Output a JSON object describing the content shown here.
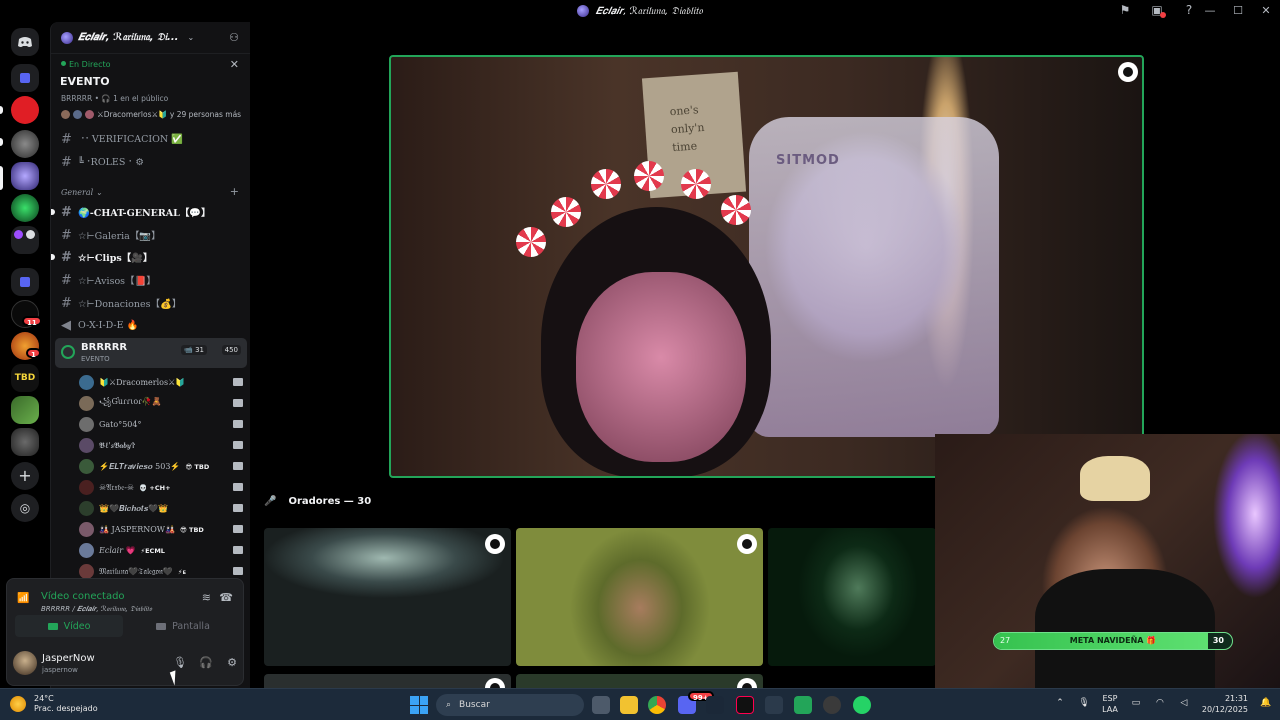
{
  "window": {
    "title": "𝑬𝒄𝒍𝒂𝒊𝒓, ℛ𝔞𝔯𝔦𝔩𝔲𝔫𝔞, 𝔇𝔦𝔞𝔟𝔩𝔦𝔱𝔬",
    "icons": [
      "flag-icon",
      "inbox-icon",
      "help-icon"
    ],
    "controls": [
      "minimize-icon",
      "maximize-icon",
      "close-icon"
    ]
  },
  "server_rail": {
    "badges": [
      "11",
      "1"
    ]
  },
  "server": {
    "name": "𝑬𝒄𝒍𝒂𝒊𝒓, ℛ𝔞𝔯𝔦𝔩𝔲𝔫𝔞, 𝔇𝔦...",
    "event": {
      "live_label": "En Directo",
      "title": "EVENTO",
      "meta": "BRRRRR • 🎧 1 en el público",
      "people": "⚔Dracomerlos⚔🔰 y 29 personas más"
    }
  },
  "channels": [
    {
      "label": "⠐⠂VERIFICACION ✅",
      "bold": false
    },
    {
      "label": "╚⠐ROLES⠐ ⚙",
      "bold": false
    },
    {
      "label": "🌍-CHAT-GENERAL【💬】",
      "bold": true
    },
    {
      "label": "☆⊢Galeria【📷】",
      "bold": false
    },
    {
      "label": "☆⊢Clips【🎥】",
      "bold": true
    },
    {
      "label": "☆⊢Avisos【📕】",
      "bold": false
    },
    {
      "label": "☆⊢Donaciones【💰】",
      "bold": false
    },
    {
      "label": "O-X-I-D-E 🔥",
      "bold": false
    }
  ],
  "category": {
    "label": "General ⌄"
  },
  "voice_channel": {
    "name": "BRRRRR",
    "sub": "EVENTO",
    "cams": "📹 31",
    "count": "450"
  },
  "voice_users": [
    {
      "name": "🔰⚔Dracomerlos⚔🔰",
      "tag": "",
      "color": "#3b6b8f"
    },
    {
      "name": "꧁Ɠuɾɾιoɾ🥀🧸",
      "tag": "",
      "color": "#7a6a58"
    },
    {
      "name": "Gato°504°",
      "tag": "",
      "color": "#6d6d6d"
    },
    {
      "name": "𝕭ℓ'𝒔𝕭𝒂𝒃𝒚✞",
      "tag": "",
      "color": "#5a4a66"
    },
    {
      "name": "⚡𝑬𝑳𝑻𝒓𝒂𝒗𝒊𝒆𝒔𝒐 503⚡",
      "tag": "😎 TBD",
      "color": "#3a5a3a"
    },
    {
      "name": "☠𝔄𝔯𝔵𝔟𝔢-☠",
      "tag": "💀 +CH+",
      "color": "#4a2020"
    },
    {
      "name": "👑🖤𝑩𝒊𝒄𝒉𝒐𝒕𝒔🖤👑",
      "tag": "",
      "color": "#2c3e2c"
    },
    {
      "name": "🎎 JASPERNOW🎎",
      "tag": "😎 TBD",
      "color": "#7a5a6a"
    },
    {
      "name": "𝐸𝑐𝑙𝑎𝑖𝑟 💗",
      "tag": "⚡ECML",
      "color": "#6a7a9a"
    },
    {
      "name": "𝔐𝔞𝔯𝔦𝔩𝔲𝔫𝔞🖤𝔗𝔞𝔩𝔢𝔤𝔬𝔫🖤",
      "tag": "⚡ᴇ",
      "color": "#6a3a3a"
    }
  ],
  "user_panel": {
    "status": "Vídeo conectado",
    "location": "BRRRRR / 𝑬𝒄𝒍𝒂𝒊𝒓, ℛ𝔞𝔯𝔦𝔩𝔲𝔫𝔞, 𝔇𝔦𝔞𝔟𝔩𝔦𝔱𝔬",
    "video_label": "Vídeo",
    "screen_label": "Pantalla",
    "display_name": "JasperNow",
    "username": "jaspernow"
  },
  "stage": {
    "note_text": "one's\nonly'n\ntime",
    "chair_text": "SITMOD"
  },
  "speakers": {
    "label": "Oradores — 30"
  },
  "overlay": {
    "goal_left": "27",
    "goal_label": "META NAVIDEÑA 🎁",
    "goal_right": "30",
    "goal_progress": 0.9
  },
  "taskbar": {
    "temp": "24°C",
    "weather": "Prac. despejado",
    "search_placeholder": "Buscar",
    "lang1": "ESP",
    "lang2": "LAA",
    "time": "21:31",
    "date": "20/12/2025",
    "discord_badge": "99+"
  },
  "colors": {
    "accent_green": "#23a559",
    "live_border": "#23a559",
    "bg": "#000000",
    "panel": "#121214"
  }
}
